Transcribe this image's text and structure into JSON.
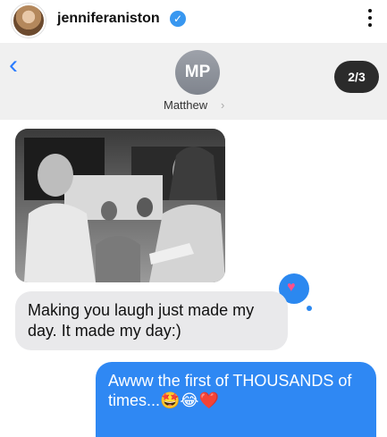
{
  "post": {
    "username": "jenniferaniston",
    "verified_mark": "✓",
    "icons": [
      "avatar",
      "verified-icon",
      "more-options-icon"
    ]
  },
  "messages_header": {
    "back_icon": "chevron-left-icon",
    "contact_initials": "MP",
    "contact_name": "Matthew",
    "contact_chevron": "›",
    "slide_counter": "2/3"
  },
  "thread": {
    "photo": "black-and-white photo of two people smiling at each other",
    "reaction": "heart",
    "incoming_message": "Making you laugh just made my day. It made my day:)",
    "outgoing_message": "Awww the first of THOUSANDS of times...🤩😂❤️"
  },
  "colors": {
    "imessage_blue": "#2f88f3",
    "incoming_gray": "#e9e9eb",
    "link_blue": "#2b7cff",
    "verified_blue": "#3897f0"
  }
}
